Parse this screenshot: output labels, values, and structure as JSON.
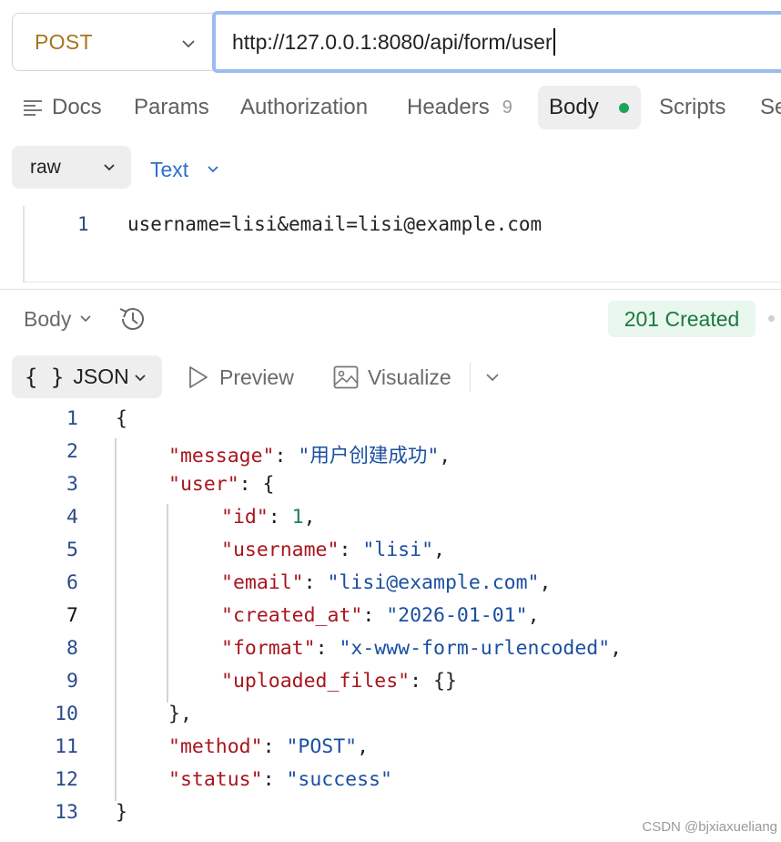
{
  "request": {
    "method": "POST",
    "url": "http://127.0.0.1:8080/api/form/user"
  },
  "tabs": {
    "docs": "Docs",
    "params": "Params",
    "authorization": "Authorization",
    "headers": "Headers",
    "headers_count": "9",
    "body": "Body",
    "scripts": "Scripts",
    "settings": "Se"
  },
  "body_mode": {
    "type": "raw",
    "format": "Text"
  },
  "request_body": {
    "line_number": "1",
    "content": "username=lisi&email=lisi@example.com"
  },
  "response": {
    "section_label": "Body",
    "status": "201 Created",
    "view_mode": "JSON",
    "view_mode_icon": "{ }",
    "preview_label": "Preview",
    "visualize_label": "Visualize",
    "lines": [
      {
        "n": "1",
        "indent": 0,
        "parts": [
          [
            "p",
            "{"
          ]
        ]
      },
      {
        "n": "2",
        "indent": 1,
        "parts": [
          [
            "k",
            "\"message\""
          ],
          [
            "p",
            ": "
          ],
          [
            "s",
            "\"用户创建成功\""
          ],
          [
            "p",
            ","
          ]
        ]
      },
      {
        "n": "3",
        "indent": 1,
        "parts": [
          [
            "k",
            "\"user\""
          ],
          [
            "p",
            ": {"
          ]
        ]
      },
      {
        "n": "4",
        "indent": 2,
        "parts": [
          [
            "k",
            "\"id\""
          ],
          [
            "p",
            ": "
          ],
          [
            "n",
            "1"
          ],
          [
            "p",
            ","
          ]
        ]
      },
      {
        "n": "5",
        "indent": 2,
        "parts": [
          [
            "k",
            "\"username\""
          ],
          [
            "p",
            ": "
          ],
          [
            "s",
            "\"lisi\""
          ],
          [
            "p",
            ","
          ]
        ]
      },
      {
        "n": "6",
        "indent": 2,
        "parts": [
          [
            "k",
            "\"email\""
          ],
          [
            "p",
            ": "
          ],
          [
            "s",
            "\"lisi@example.com\""
          ],
          [
            "p",
            ","
          ]
        ]
      },
      {
        "n": "7",
        "indent": 2,
        "parts": [
          [
            "k",
            "\"created_at\""
          ],
          [
            "p",
            ": "
          ],
          [
            "s",
            "\"2026-01-01\""
          ],
          [
            "p",
            ","
          ]
        ]
      },
      {
        "n": "8",
        "indent": 2,
        "parts": [
          [
            "k",
            "\"format\""
          ],
          [
            "p",
            ": "
          ],
          [
            "s",
            "\"x-www-form-urlencoded\""
          ],
          [
            "p",
            ","
          ]
        ]
      },
      {
        "n": "9",
        "indent": 2,
        "parts": [
          [
            "k",
            "\"uploaded_files\""
          ],
          [
            "p",
            ": {}"
          ]
        ]
      },
      {
        "n": "10",
        "indent": 1,
        "parts": [
          [
            "p",
            "},"
          ]
        ]
      },
      {
        "n": "11",
        "indent": 1,
        "parts": [
          [
            "k",
            "\"method\""
          ],
          [
            "p",
            ": "
          ],
          [
            "s",
            "\"POST\""
          ],
          [
            "p",
            ","
          ]
        ]
      },
      {
        "n": "12",
        "indent": 1,
        "parts": [
          [
            "k",
            "\"status\""
          ],
          [
            "p",
            ": "
          ],
          [
            "s",
            "\"success\""
          ]
        ]
      },
      {
        "n": "13",
        "indent": 0,
        "parts": [
          [
            "p",
            "}"
          ]
        ]
      }
    ]
  },
  "watermark": "CSDN @bjxiaxueliang"
}
